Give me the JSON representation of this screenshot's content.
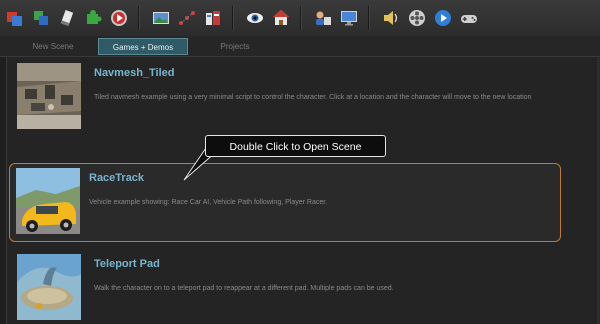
{
  "toolbar": {
    "icons": [
      "scene-icon",
      "layers-icon",
      "script-icon",
      "puzzle-icon",
      "record-icon",
      "image-icon",
      "path-icon",
      "building-icon",
      "eye-icon",
      "home-icon",
      "user-icon",
      "monitor-icon",
      "volume-icon",
      "film-icon",
      "play-icon",
      "gamepad-icon"
    ]
  },
  "tabs": {
    "new_scene": "New Scene",
    "games_demos": "Games + Demos",
    "projects": "Projects"
  },
  "scenes": [
    {
      "title": "Navmesh_Tiled",
      "description": "Tiled navmesh example using a very minimal script to control the character. Click at a location and the character will move to the new location"
    },
    {
      "title": "RaceTrack",
      "description": "Vehicle example showing: Race Car AI, Vehicle Path following, Player Racer."
    },
    {
      "title": "Teleport Pad",
      "description": "Walk the character on to a teleport pad to reappear at a different pad. Multiple pads can be used."
    }
  ],
  "callout": {
    "text": "Double Click to Open Scene"
  },
  "colors": {
    "accent": "#79b4cf",
    "selection_border": "#c07a2e",
    "active_tab": "#2f5a66"
  }
}
